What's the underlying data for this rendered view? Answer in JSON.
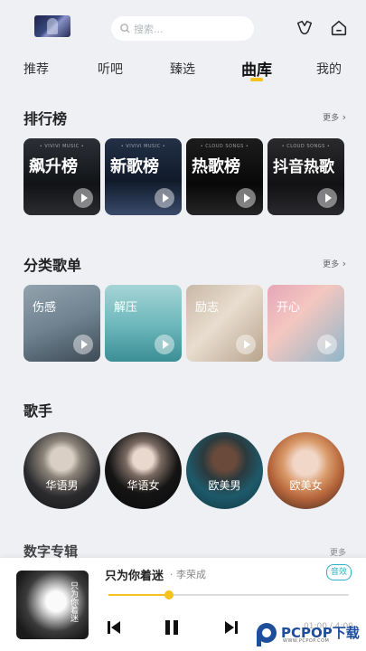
{
  "header": {
    "search_placeholder": "搜索...",
    "icons": [
      "avatar-thumbnail",
      "search-icon",
      "vip-icon",
      "home-icon"
    ]
  },
  "tabs": [
    {
      "label": "推荐",
      "active": false
    },
    {
      "label": "听吧",
      "active": false
    },
    {
      "label": "臻选",
      "active": false
    },
    {
      "label": "曲库",
      "active": true
    },
    {
      "label": "我的",
      "active": false
    }
  ],
  "charts": {
    "title": "排行榜",
    "more": "更多",
    "items": [
      {
        "label": "飙升榜",
        "caption": "• VIVIVI MUSIC •"
      },
      {
        "label": "新歌榜",
        "caption": "• VIVIVI MUSIC •"
      },
      {
        "label": "热歌榜",
        "caption": "• CLOUD SONGS •"
      },
      {
        "label": "抖音热歌",
        "caption": "• CLOUD SONGS •"
      }
    ]
  },
  "categories": {
    "title": "分类歌单",
    "more": "更多",
    "items": [
      {
        "label": "伤感"
      },
      {
        "label": "解压"
      },
      {
        "label": "励志"
      },
      {
        "label": "开心"
      }
    ]
  },
  "singers": {
    "title": "歌手",
    "items": [
      {
        "label": "华语男"
      },
      {
        "label": "华语女"
      },
      {
        "label": "欧美男"
      },
      {
        "label": "欧美女"
      }
    ]
  },
  "next_section": {
    "title": "数字专辑",
    "more": "更多"
  },
  "player": {
    "cover_text": "只为你着迷",
    "title": "只为你着迷",
    "artist": "李荣成",
    "lyric_label": "音效",
    "progress": 0.25,
    "time": "01:00 / 4:00"
  },
  "watermark": {
    "brand": "PCPOP下载",
    "sub": "WWW.PCPOP.COM"
  },
  "colors": {
    "accent": "#f4c21a",
    "lyric": "#2fb0c6"
  }
}
